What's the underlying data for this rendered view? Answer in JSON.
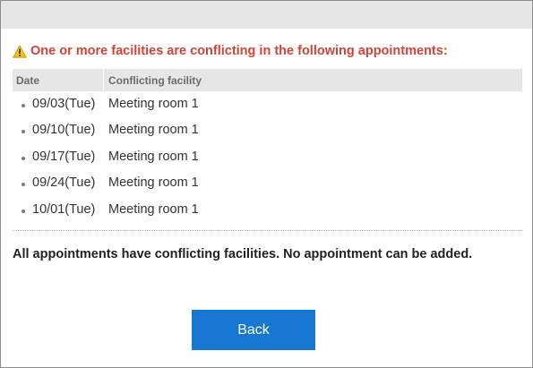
{
  "warning": {
    "icon": "warning-triangle-icon",
    "text": "One or more facilities are conflicting in the following appointments:",
    "color": "#d04437"
  },
  "table": {
    "headers": {
      "date": "Date",
      "facility": "Conflicting facility"
    },
    "rows": [
      {
        "date": "09/03(Tue)",
        "facility": "Meeting room 1"
      },
      {
        "date": "09/10(Tue)",
        "facility": "Meeting room 1"
      },
      {
        "date": "09/17(Tue)",
        "facility": "Meeting room 1"
      },
      {
        "date": "09/24(Tue)",
        "facility": "Meeting room 1"
      },
      {
        "date": "10/01(Tue)",
        "facility": "Meeting room 1"
      }
    ]
  },
  "notice": "All appointments have conflicting facilities. No appointment can be added.",
  "buttons": {
    "back_label": "Back",
    "back_color": "#1677d2"
  }
}
